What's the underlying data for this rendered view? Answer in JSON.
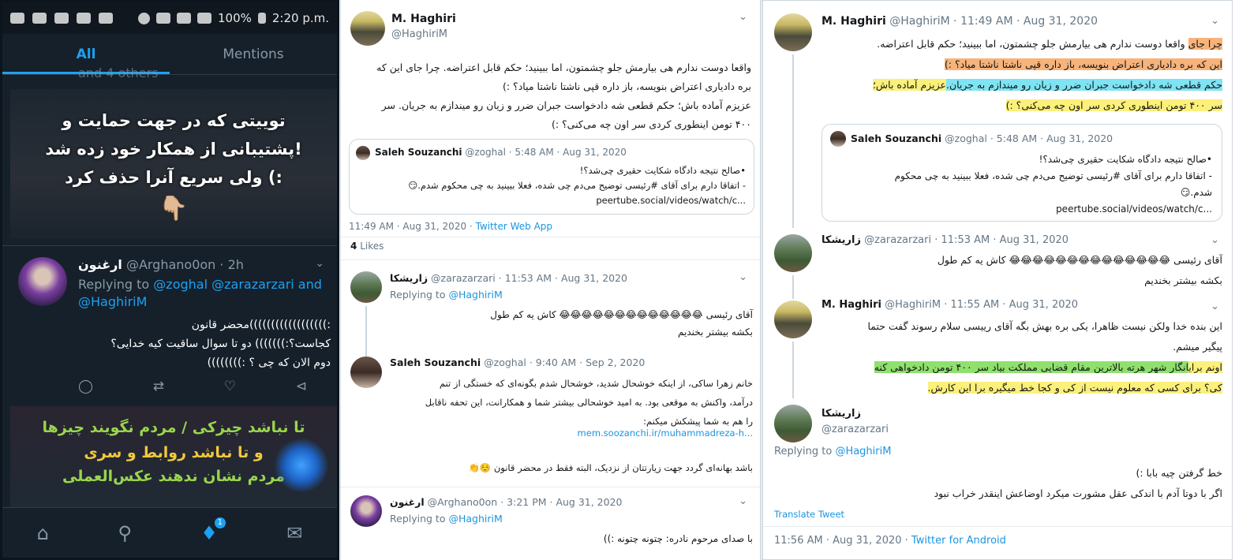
{
  "phone": {
    "status": {
      "time": "2:20 p.m.",
      "battery": "100%"
    },
    "tabs": [
      "All",
      "Mentions"
    ],
    "truncated_text": "and 4 others",
    "promo_top": {
      "line1": "توییتی که در جهت حمایت و",
      "line2": "پشتیبانی از همکار خود زده شد!",
      "line3": "ولی سریع آنرا حذف کرد (:",
      "emoji": "👇🏼"
    },
    "tweet": {
      "name": "ارغنون",
      "handle": "@Arghano0on",
      "time": "2h",
      "replying_prefix": "Replying to",
      "replying_to": "@zoghal @zarazarzari and @HaghiriM",
      "body": [
        ":))))))))))))))))))محضر قانون",
        "کجاست؟:))))))) دو تا سوال ساقیت کیه خدایی؟",
        "دوم الان که چی ؟ :))))))))"
      ]
    },
    "promo_bottom": {
      "line1": "تا نباشد چیزکی / مردم نگویند چیزها",
      "line2": "و تا نباشد روابط و سری",
      "line3": "مردم نشان ندهند عکس‌العملی"
    },
    "nav_badge": "1"
  },
  "middle": {
    "main": {
      "name": "M. Haghiri",
      "handle": "@HaghiriM",
      "body": [
        "واقعا دوست ندارم هی بیارمش جلو چشمتون، اما ببینید؛ حکم قابل اعتراضه. چرا جای این که",
        "بره دادیاری اعتراض بنویسه، باز داره قپی ناشتا ناشتا میاد؟ :)",
        "عزیزم آماده باش؛ حکم قطعی شه دادخواست جبران ضرر و زیان رو میندازم به جریان. سر",
        "۴۰۰ تومن اینطوری کردی سر اون چه می‌کنی؟ :)"
      ],
      "quote": {
        "name": "Saleh Souzanchi",
        "handle": "@zoghal",
        "time": "5:48 AM · Aug 31, 2020",
        "body": [
          "•صالح نتیجه دادگاه شکایت حقیری چی‌شد؟!",
          "- اتفاقا دارم برای آقای #رئیسی توضیح می‌دم چی شده، فعلا ببینید به چی محکوم شدم.😏",
          "peertube.social/videos/watch/c..."
        ]
      },
      "time": "11:49 AM · Aug 31, 2020",
      "via": "Twitter Web App",
      "likes_count": "4",
      "likes_label": "Likes"
    },
    "reply1": {
      "name": "زاریشکا",
      "handle": "@zarazarzari",
      "time": "11:53 AM · Aug 31, 2020",
      "replying_prefix": "Replying to",
      "replying_to": "@HaghiriM",
      "body": [
        "آقای رئیسی 😂😂😂😂😂😂😂😂😂😂😂😂😂 کاش یه کم طول",
        "بکشه بیشتر بخندیم"
      ]
    },
    "reply2": {
      "name": "Saleh Souzanchi",
      "handle": "@zoghal",
      "time": "9:40 AM · Sep 2, 2020",
      "body": [
        "خانم زهرا ساکی، از اینکه خوشحال شدید، خوشحال شدم بگونه‌ای که خستگی از تنم",
        "درآمد، واکنش به موقعی بود. به امید خوشحالی بیشتر شما و همکارانت، این تحفه ناقابل",
        "را هم به شما پیشکش میکنم:"
      ],
      "link": "mem.soozanchi.ir/muhammadreza-h...",
      "body2": "باشد بهانه‌ای گردد جهت زیارتتان از نزدیک، البته فقط در محضر قانون ☺️👏"
    },
    "reply3": {
      "name": "ارغنون",
      "handle": "@Arghano0on",
      "time": "3:21 PM · Aug 31, 2020",
      "replying_prefix": "Replying to",
      "replying_to": "@HaghiriM",
      "body": "با صدای مرحوم نادره: چتونه چتونه :))"
    }
  },
  "right": {
    "main": {
      "name": "M. Haghiri",
      "handle": "@HaghiriM",
      "time": "11:49 AM · Aug 31, 2020",
      "body_l1a": "واقعا دوست ندارم هی بیارمش جلو چشمتون، اما ببینید؛ حکم قابل اعتراضه.",
      "body_l1b": "چرا جای",
      "body_l2": "این که بره دادیاری اعتراض بنویسه، باز داره قپی ناشتا ناشتا میاد؟ :)",
      "body_l3a": "عزیزم آماده باش؛",
      "body_l3b": "حکم قطعی شه دادخواست جبران ضرر و زیان رو میندازم به جریان.",
      "body_l4a": "سر ۴۰۰ تومن اینطوری کردی سر اون چه می‌کنی؟ :)",
      "quote": {
        "name": "Saleh Souzanchi",
        "handle": "@zoghal",
        "time": "5:48 AM · Aug 31, 2020",
        "body": [
          "•صالح نتیجه دادگاه شکایت حقیری چی‌شد؟!",
          "- اتفاقا دارم برای آقای #رئیسی توضیح می‌دم چی شده، فعلا ببینید به چی محکوم",
          "شدم.😏",
          "peertube.social/videos/watch/c..."
        ]
      }
    },
    "reply1": {
      "name": "زاریشکا",
      "handle": "@zarazarzari",
      "time": "11:53 AM · Aug 31, 2020",
      "body": [
        "آقای رئیسی 😂😂😂😂😂😂😂😂😂😂😂😂😂😂 کاش یه کم طول",
        "بکشه بیشتر بخندیم"
      ]
    },
    "reply2": {
      "name": "M. Haghiri",
      "handle": "@HaghiriM",
      "time": "11:55 AM · Aug 31, 2020",
      "body_l1": "این بنده خدا ولکن نیست ظاهرا، یکی بره بهش بگه آقای رییسی سلام رسوند گفت حتما",
      "body_l2": "پیگیر میشم.",
      "body_l3a": "انگار شهر هرته بالاترین مقام قضایی مملکت بیاد سر ۴۰۰ تومن دادخواهی کنه",
      "body_l3b": "اونم برای",
      "body_l4": "کی؟ برای کسی که معلوم نیست از کی و کجا خط میگیره برا این کارش."
    },
    "reply3": {
      "name": "زاریشکا",
      "handle": "@zarazarzari",
      "replying_prefix": "Replying to",
      "replying_to": "@HaghiriM",
      "body": [
        "خط گرفتن چیه بابا :)",
        "اگر با دوتا آدم با اندکی عقل مشورت میکرد اوضاعش اینقدر خراب نبود"
      ],
      "translate": "Translate Tweet",
      "time": "11:56 AM · Aug 31, 2020",
      "via": "Twitter for Android"
    }
  }
}
